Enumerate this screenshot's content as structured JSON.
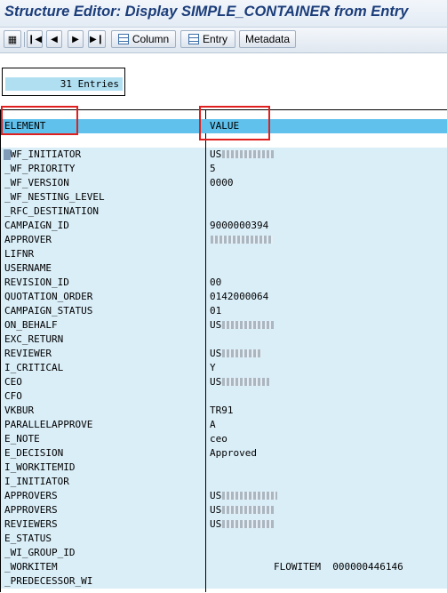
{
  "window": {
    "title": "Structure Editor: Display SIMPLE_CONTAINER from Entry"
  },
  "toolbar": {
    "column_label": "Column",
    "entry_label": "Entry",
    "metadata_label": "Metadata"
  },
  "entries": {
    "count_text": "31 Entries"
  },
  "table": {
    "headers": {
      "element": "ELEMENT",
      "value": "VALUE"
    },
    "rows": [
      {
        "element": "_WF_INITIATOR",
        "value": "US",
        "redacted": true
      },
      {
        "element": "_WF_PRIORITY",
        "value": "5"
      },
      {
        "element": "_WF_VERSION",
        "value": "0000"
      },
      {
        "element": "_WF_NESTING_LEVEL",
        "value": ""
      },
      {
        "element": "_RFC_DESTINATION",
        "value": ""
      },
      {
        "element": "CAMPAIGN_ID",
        "value": "9000000394"
      },
      {
        "element": "APPROVER",
        "value": "",
        "redacted": true
      },
      {
        "element": "LIFNR",
        "value": ""
      },
      {
        "element": "USERNAME",
        "value": ""
      },
      {
        "element": "REVISION_ID",
        "value": "00"
      },
      {
        "element": "QUOTATION_ORDER",
        "value": "0142000064"
      },
      {
        "element": "CAMPAIGN_STATUS",
        "value": "01"
      },
      {
        "element": "ON_BEHALF",
        "value": "US",
        "redacted": true
      },
      {
        "element": "EXC_RETURN",
        "value": ""
      },
      {
        "element": "REVIEWER",
        "value": "US",
        "redacted": true
      },
      {
        "element": "I_CRITICAL",
        "value": "Y"
      },
      {
        "element": "CEO",
        "value": "US",
        "redacted": true
      },
      {
        "element": "CFO",
        "value": ""
      },
      {
        "element": "VKBUR",
        "value": "TR91"
      },
      {
        "element": "PARALLELAPPROVE",
        "value": "A"
      },
      {
        "element": "E_NOTE",
        "value": "ceo"
      },
      {
        "element": "E_DECISION",
        "value": "Approved"
      },
      {
        "element": "I_WORKITEMID",
        "value": ""
      },
      {
        "element": "I_INITIATOR",
        "value": ""
      },
      {
        "element": "APPROVERS",
        "value": "US",
        "redacted": true
      },
      {
        "element": "APPROVERS",
        "value": "US",
        "redacted": true
      },
      {
        "element": "REVIEWERS",
        "value": "US",
        "redacted": true
      },
      {
        "element": "E_STATUS",
        "value": ""
      },
      {
        "element": "_WI_GROUP_ID",
        "value": ""
      },
      {
        "element": "_WORKITEM",
        "value": "",
        "tail": "FLOWITEM  000000446146"
      },
      {
        "element": "_PREDECESSOR_WI",
        "value": ""
      }
    ]
  }
}
